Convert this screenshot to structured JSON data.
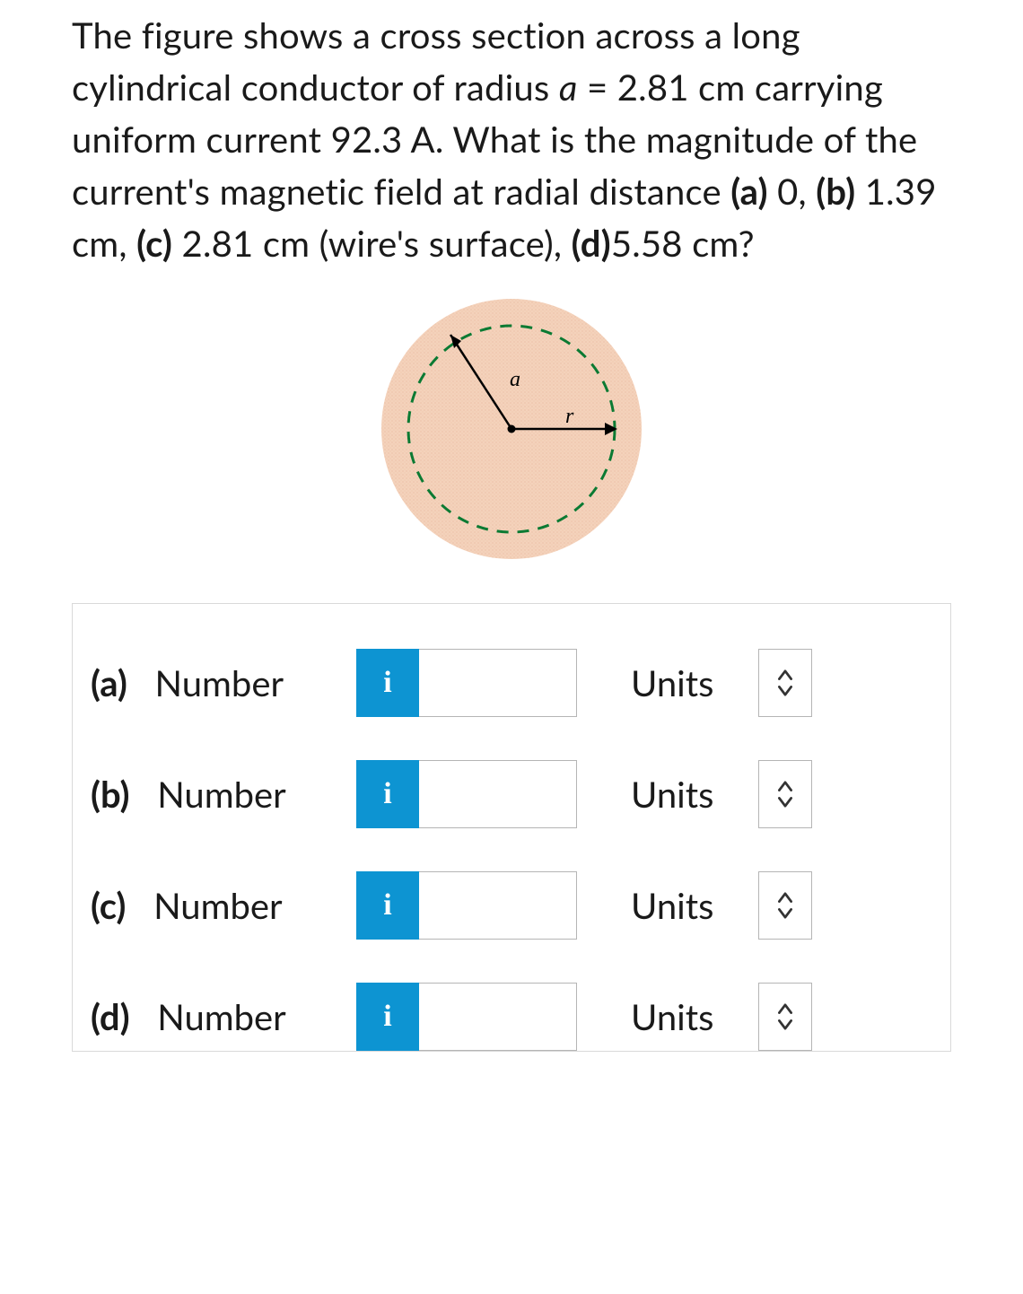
{
  "question": {
    "pre_a": "The figure shows a cross section across a long cylindrical conductor of radius ",
    "var_a": "a",
    "eq": " = ",
    "radius": "2.81 cm",
    "post_radius": " carrying uniform current ",
    "current": "92.3 A",
    "post_current": ". What is the magnitude of the current's magnetic field at radial distance ",
    "part_a_lbl": "(a)",
    "part_a_val": " 0, ",
    "part_b_lbl": "(b)",
    "part_b_val": " 1.39 cm, ",
    "part_c_lbl": "(c)",
    "part_c_val": " 2.81 cm (wire's surface), ",
    "part_d_lbl": "(d)",
    "part_d_val": "5.58 cm?"
  },
  "figure": {
    "label_a": "a",
    "label_r": "r"
  },
  "rows": [
    {
      "id": "a",
      "label_part": "(a)",
      "label_rest": "   Number",
      "info": "i",
      "units": "Units",
      "value": ""
    },
    {
      "id": "b",
      "label_part": "(b)",
      "label_rest": "   Number",
      "info": "i",
      "units": "Units",
      "value": ""
    },
    {
      "id": "c",
      "label_part": "(c)",
      "label_rest": "   Number",
      "info": "i",
      "units": "Units",
      "value": ""
    },
    {
      "id": "d",
      "label_part": "(d)",
      "label_rest": "   Number",
      "info": "i",
      "units": "Units",
      "value": ""
    }
  ]
}
